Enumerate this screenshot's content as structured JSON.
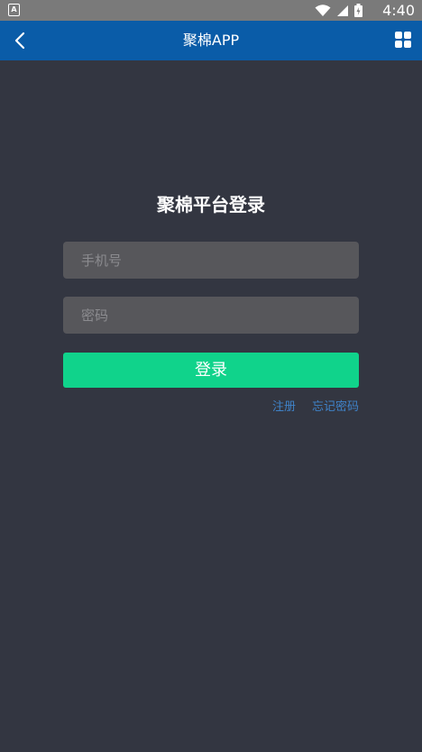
{
  "status_bar": {
    "app_badge": "A",
    "time": "4:40",
    "icons": [
      "wifi-icon",
      "signal-icon",
      "battery-icon"
    ]
  },
  "header": {
    "title": "聚棉APP",
    "back_icon": "chevron-left-icon",
    "menu_icon": "grid-icon",
    "bg_color": "#0a5ca8"
  },
  "login": {
    "title": "聚棉平台登录",
    "phone_placeholder": "手机号",
    "password_placeholder": "密码",
    "login_label": "登录",
    "register_label": "注册",
    "forgot_label": "忘记密码",
    "button_color": "#10d38b",
    "link_color": "#3f82c8",
    "background_color": "#333641"
  }
}
